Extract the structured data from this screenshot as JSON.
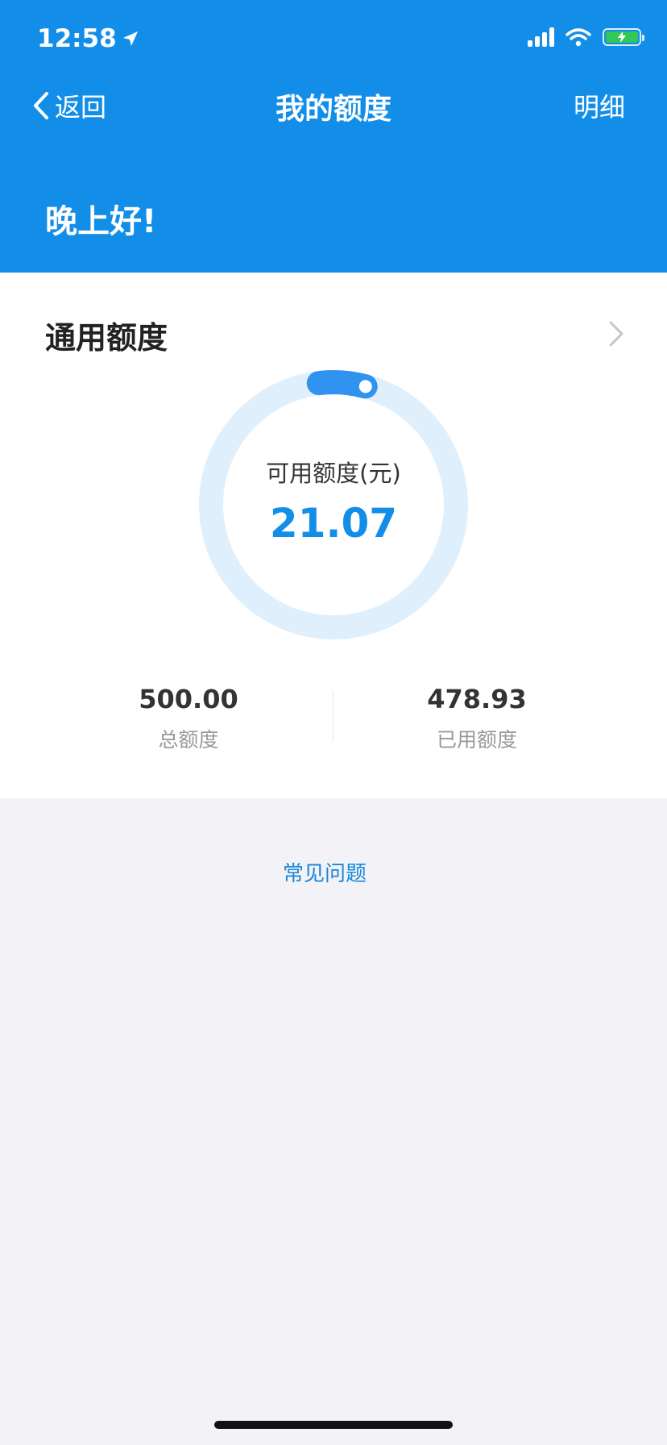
{
  "status_bar": {
    "time": "12:58"
  },
  "nav": {
    "back_label": "返回",
    "title": "我的额度",
    "detail_label": "明细"
  },
  "greeting": "晚上好!",
  "credit": {
    "title": "通用额度",
    "available_label": "可用额度(元)",
    "available_value": "21.07",
    "total_value": "500.00",
    "total_label": "总额度",
    "used_value": "478.93",
    "used_label": "已用额度",
    "available_fraction": 0.0421
  },
  "faq_label": "常见问题",
  "colors": {
    "brand": "#138ee8",
    "ring_track": "#dff0fc",
    "ring_fill": "#2f93ef",
    "background": "#f3f3f7"
  }
}
